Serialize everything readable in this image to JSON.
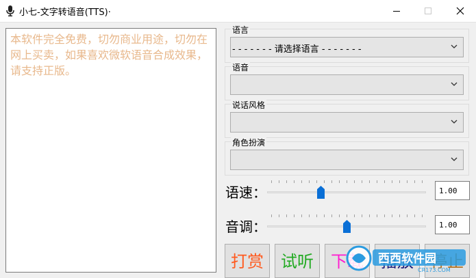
{
  "window": {
    "title": "小七-文字转语音(TTS)·"
  },
  "text_area": {
    "value": "本软件完全免费，切勿商业用途，切勿在网上买卖，如果喜欢微软语音合成效果，请支持正版。"
  },
  "groups": [
    {
      "label": "语言",
      "selected": "- - - - - - - 请选择语言 - - - - - - -"
    },
    {
      "label": "语音",
      "selected": ""
    },
    {
      "label": "说话风格",
      "selected": ""
    },
    {
      "label": "角色扮演",
      "selected": ""
    }
  ],
  "sliders": {
    "speed": {
      "label": "语速：",
      "value": "1.00",
      "position": 0.34
    },
    "pitch": {
      "label": "音调：",
      "value": "1.00",
      "position": 0.5
    }
  },
  "buttons": {
    "reward": "打赏",
    "preview": "试听",
    "download": "下载",
    "play": "播放",
    "stop": "停止"
  },
  "watermark": {
    "text": "西西软件园",
    "subtext": "CR173.COM"
  },
  "colors": {
    "reward": "#ff5a1e",
    "preview": "#22aa22",
    "download": "#ff1bd0",
    "play": "#1a1a7a",
    "stop": "#b07020",
    "hint_text": "#e8b88c",
    "thumb": "#0a6fd6"
  }
}
